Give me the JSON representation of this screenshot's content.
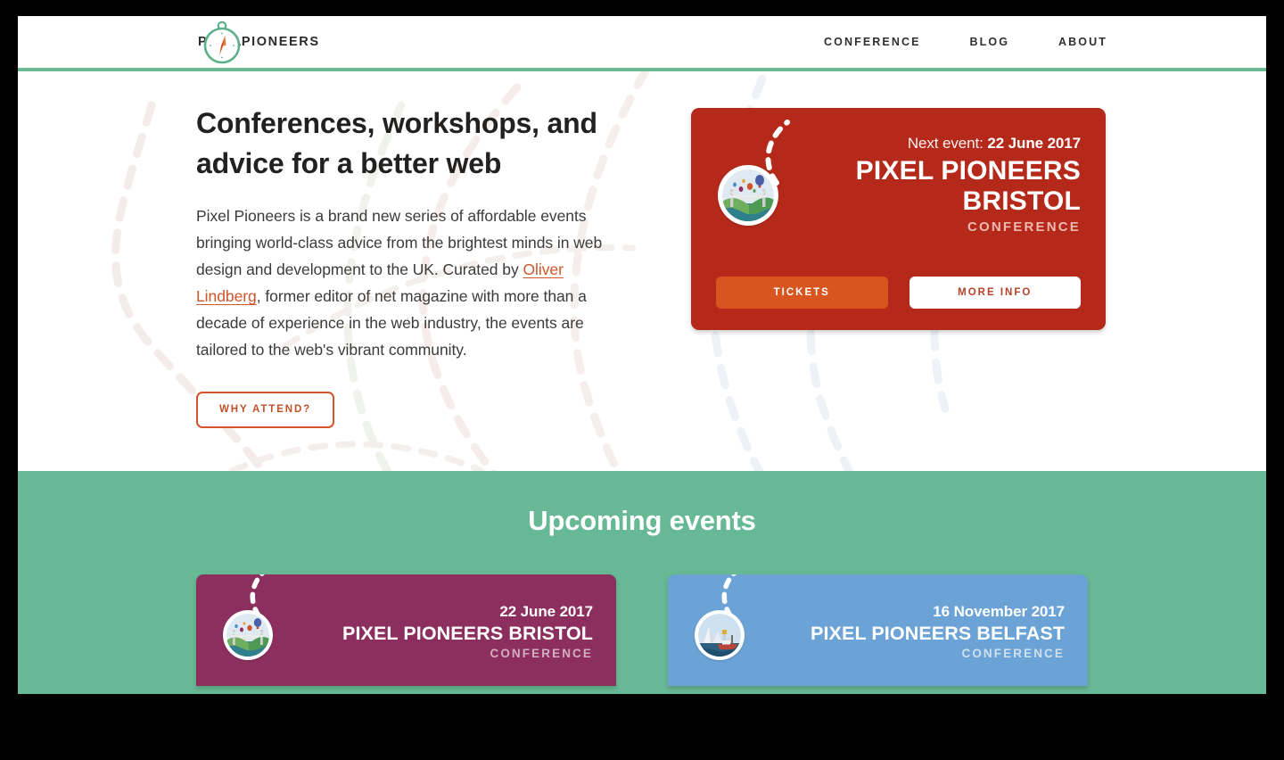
{
  "site": {
    "logo_text_first": "PIXEL",
    "logo_text_second": "PIONEERS",
    "logo_icon": "compass-icon",
    "accent_green": "#67b894",
    "accent_red": "#b4291a",
    "accent_orange": "#d9551f",
    "accent_purple": "#8c2f5e",
    "accent_blue": "#6ba3d6",
    "link_color": "#d1542a"
  },
  "nav": {
    "items": [
      {
        "label": "CONFERENCE"
      },
      {
        "label": "BLOG"
      },
      {
        "label": "ABOUT"
      }
    ]
  },
  "hero": {
    "title": "Conferences, workshops, and advice for a better web",
    "body_part1": "Pixel Pioneers is a brand new series of affordable events bringing world-class advice from the brightest minds in web design and development to the UK. Curated by ",
    "body_link": "Oliver Lindberg",
    "body_part2": ", former editor of net magazine with more than a decade of experience in the web industry, the events are tailored to the web's vibrant community.",
    "cta_label": "WHY ATTEND?"
  },
  "featured_event": {
    "next_event_label": "Next event:",
    "date": "22 June 2017",
    "name": "PIXEL PIONEERS BRISTOL",
    "type": "CONFERENCE",
    "badge_icon": "bristol-bridge-balloons-icon",
    "tickets_label": "TICKETS",
    "more_info_label": "MORE INFO"
  },
  "upcoming": {
    "heading": "Upcoming events",
    "events": [
      {
        "date": "22 June 2017",
        "name": "PIXEL PIONEERS BRISTOL",
        "type": "CONFERENCE",
        "badge_icon": "bristol-bridge-balloons-icon",
        "color": "#8c2f5e"
      },
      {
        "date": "16 November 2017",
        "name": "PIXEL PIONEERS BELFAST",
        "type": "CONFERENCE",
        "badge_icon": "belfast-harbour-ship-icon",
        "color": "#6ba3d6"
      }
    ]
  }
}
